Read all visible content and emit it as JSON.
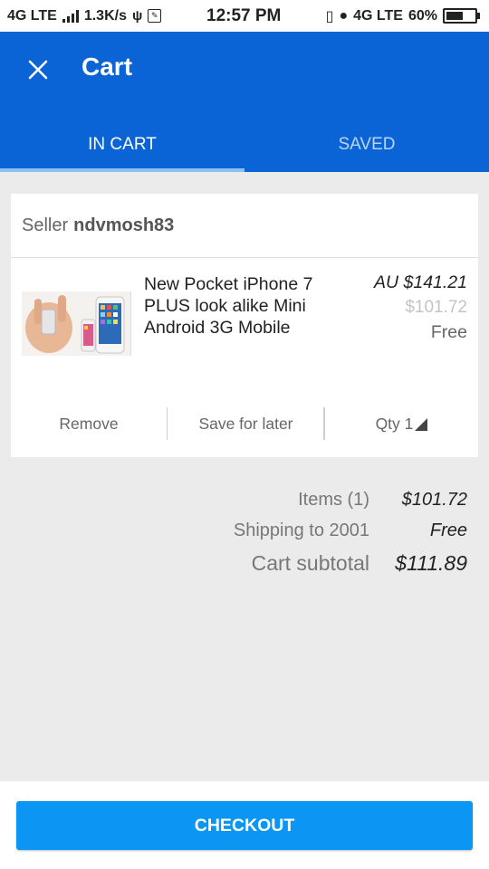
{
  "status_bar": {
    "network_left": "4G LTE",
    "speed": "1.3K/s",
    "time": "12:57 PM",
    "network_right": "4G LTE",
    "battery": "60%",
    "battery_level": 0.6
  },
  "app_bar": {
    "title": "Cart",
    "close_icon": "close-icon",
    "accent_color": "#0a64d6"
  },
  "tabs": [
    {
      "label": "IN CART",
      "active": true
    },
    {
      "label": "SAVED",
      "active": false
    }
  ],
  "cart": {
    "seller_label": "Seller",
    "seller_name": "ndvmosh83",
    "item": {
      "title": "New Pocket iPhone 7 PLUS look alike Mini Android 3G Mobile",
      "price": "AU $141.21",
      "converted_price": "$101.72",
      "shipping": "Free"
    },
    "actions": {
      "remove": "Remove",
      "save_for_later": "Save for later",
      "qty": "Qty 1"
    }
  },
  "summary": {
    "items_label": "Items (1)",
    "items_value": "$101.72",
    "shipping_label": "Shipping to 2001",
    "shipping_value": "Free",
    "subtotal_label": "Cart subtotal",
    "subtotal_value": "$111.89"
  },
  "checkout": {
    "label": "CHECKOUT",
    "color": "#0a96f2"
  }
}
